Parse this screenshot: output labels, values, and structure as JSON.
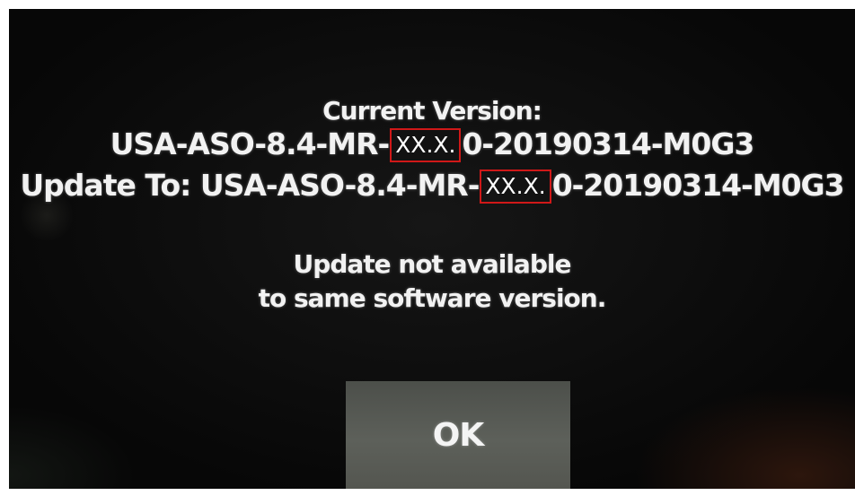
{
  "dialog": {
    "current_label": "Current Version:",
    "current_prefix": "USA-ASO-8.4-MR-",
    "current_redacted": "XX.X.",
    "current_suffix": "0-20190314-M0G3",
    "update_prefix": "Update To: USA-ASO-8.4-MR-",
    "update_redacted": "XX.X.",
    "update_suffix": "0-20190314-M0G3",
    "message_line1": "Update not available",
    "message_line2": "to same software version.",
    "ok_label": "OK"
  },
  "colors": {
    "background": "#0b0b0b",
    "text": "#f2f2f2",
    "button": "#575a54",
    "redaction_border": "#d01818"
  }
}
